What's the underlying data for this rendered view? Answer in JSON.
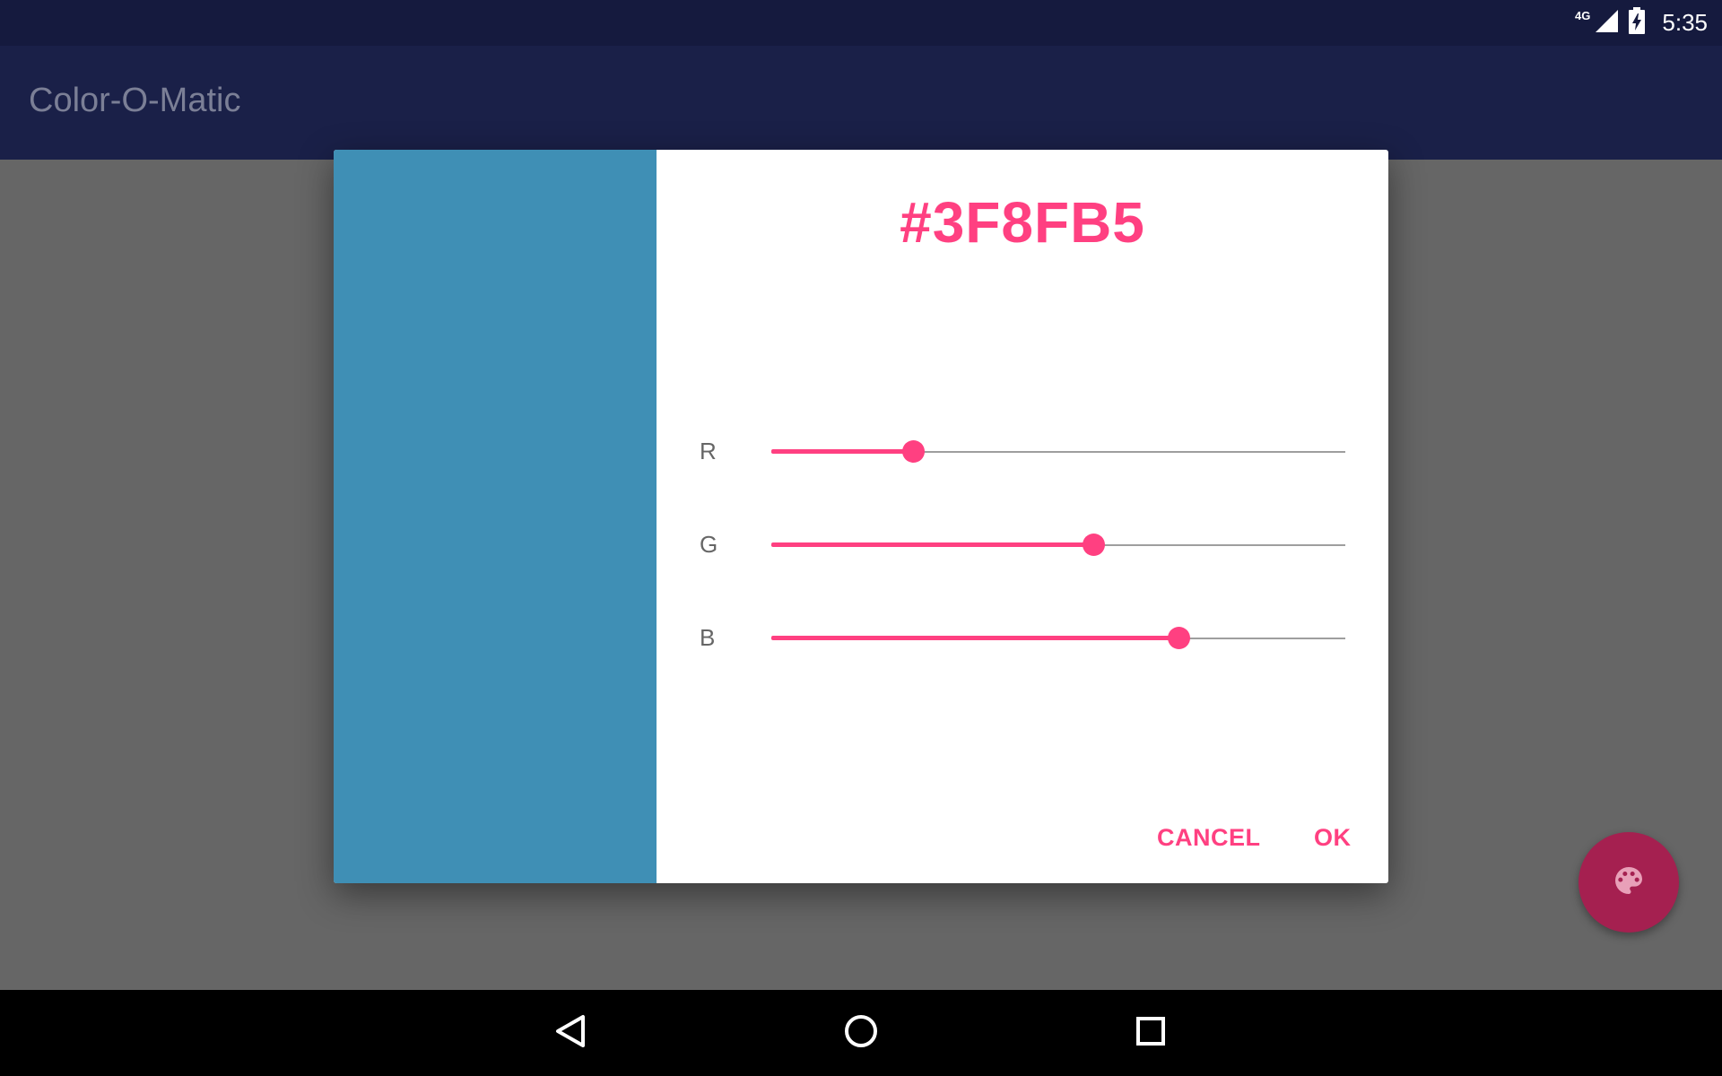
{
  "status_bar": {
    "network_type": "4G",
    "time": "5:35",
    "icons": [
      "signal-icon",
      "battery-charging-icon"
    ]
  },
  "app_bar": {
    "title": "Color-O-Matic"
  },
  "dialog": {
    "hex_value": "#3F8FB5",
    "swatch_color": "#3F8FB5",
    "accent_color": "#FF4081",
    "sliders": [
      {
        "label": "R",
        "value": 63,
        "max": 255
      },
      {
        "label": "G",
        "value": 143,
        "max": 255
      },
      {
        "label": "B",
        "value": 181,
        "max": 255
      }
    ],
    "buttons": {
      "cancel": "CANCEL",
      "ok": "OK"
    }
  },
  "fab": {
    "icon": "palette-icon",
    "color": "#A52050"
  },
  "nav_bar": {
    "icons": [
      "back-icon",
      "home-icon",
      "recents-icon"
    ]
  }
}
